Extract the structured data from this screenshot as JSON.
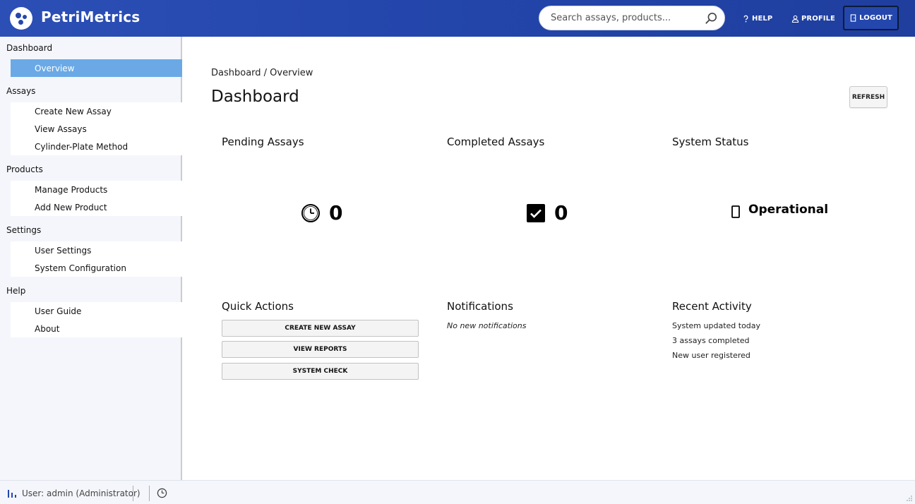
{
  "app": {
    "name": "PetriMetrics"
  },
  "header": {
    "search_placeholder": "Search assays, products...",
    "help_label": "HELP",
    "profile_label": "PROFILE",
    "logout_label": "LOGOUT"
  },
  "sidebar": {
    "sections": [
      {
        "label": "Dashboard",
        "items": [
          "Overview"
        ]
      },
      {
        "label": "Assays",
        "items": [
          "Create New Assay",
          "View Assays",
          "Cylinder-Plate Method"
        ]
      },
      {
        "label": "Products",
        "items": [
          "Manage Products",
          "Add New Product"
        ]
      },
      {
        "label": "Settings",
        "items": [
          "User Settings",
          "System Configuration"
        ]
      },
      {
        "label": "Help",
        "items": [
          "User Guide",
          "About"
        ]
      }
    ],
    "active_item": "Overview"
  },
  "main": {
    "breadcrumb": "Dashboard / Overview",
    "title": "Dashboard",
    "refresh_label": "REFRESH",
    "pending": {
      "title": "Pending Assays",
      "value": "0"
    },
    "completed": {
      "title": "Completed Assays",
      "value": "0"
    },
    "system": {
      "title": "System Status",
      "value": "Operational"
    },
    "quick_actions": {
      "title": "Quick Actions",
      "buttons": [
        "CREATE NEW ASSAY",
        "VIEW REPORTS",
        "SYSTEM CHECK"
      ]
    },
    "notifications": {
      "title": "Notifications",
      "empty_text": "No new notifications"
    },
    "recent_activity": {
      "title": "Recent Activity",
      "items": [
        "System updated today",
        "3 assays completed",
        "New user registered"
      ]
    }
  },
  "statusbar": {
    "user_text": "User: admin (Administrator)"
  },
  "colors": {
    "header": "#2447ad",
    "active_item": "#6aa9e6",
    "sidebar_bg": "#f4f6fb"
  }
}
